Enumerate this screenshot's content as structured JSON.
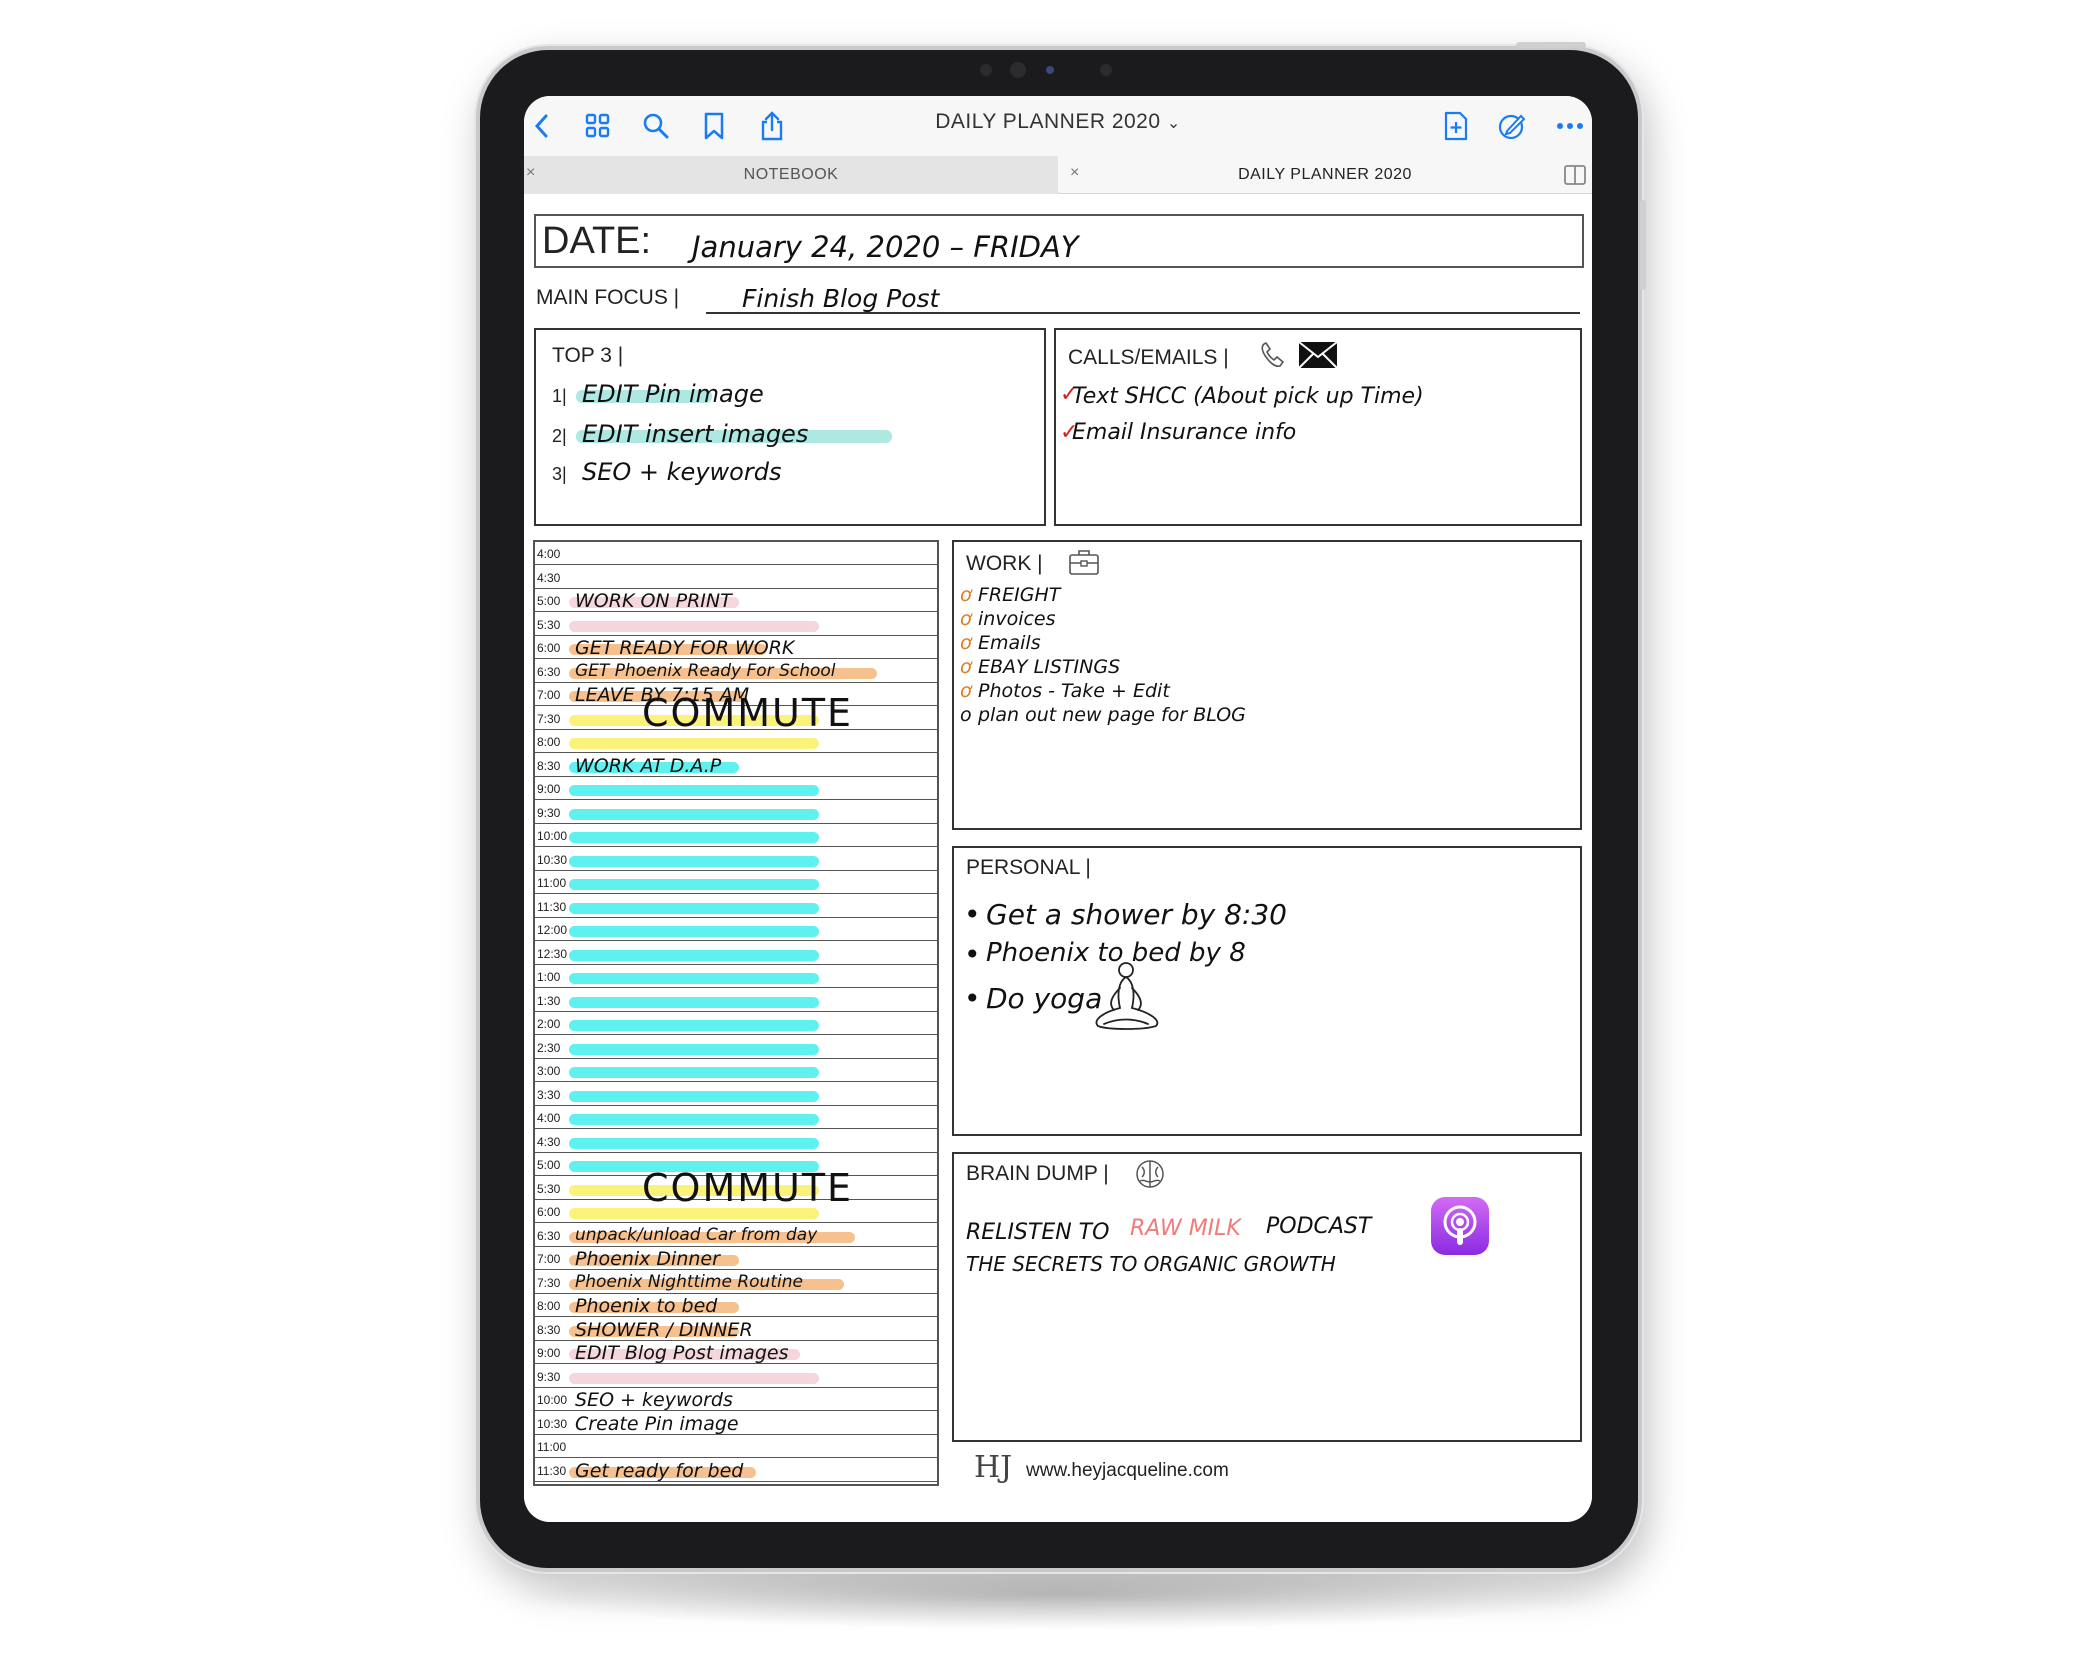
{
  "toolbar": {
    "back_icon": "chevron-left-icon",
    "grid_icon": "grid-icon",
    "search_icon": "search-icon",
    "bookmark_icon": "bookmark-icon",
    "share_icon": "share-icon",
    "title": "DAILY PLANNER 2020",
    "title_chevron": "⌄",
    "add_page_icon": "add-page-icon",
    "pen_icon": "pen-icon",
    "more_icon": "more-icon",
    "accent": "#1a7cf5"
  },
  "tabs": [
    {
      "label": "NOTEBOOK",
      "close": "×"
    },
    {
      "label": "DAILY PLANNER 2020",
      "close": "×"
    }
  ],
  "planner": {
    "date_label": "DATE:",
    "date_value": "January 24, 2020 – FRIDAY",
    "main_focus_label": "MAIN FOCUS  |",
    "main_focus_value": "Finish Blog Post",
    "top3": {
      "title": "TOP 3 |",
      "items": [
        {
          "num": "1|",
          "text": "EDIT Pin image"
        },
        {
          "num": "2|",
          "text": "EDIT insert images"
        },
        {
          "num": "3|",
          "text": "SEO + keywords"
        }
      ]
    },
    "calls": {
      "title": "CALLS/EMAILS |",
      "items": [
        {
          "check": "✓",
          "text": "Text SHCC (About pick up Time)"
        },
        {
          "check": "✓",
          "text": "Email Insurance info"
        }
      ]
    },
    "work": {
      "title": "WORK |",
      "items": [
        {
          "mark": "ơ",
          "text": "FREIGHT"
        },
        {
          "mark": "ơ",
          "text": "invoices"
        },
        {
          "mark": "ơ",
          "text": "Emails"
        },
        {
          "mark": "ơ",
          "text": "EBAY LISTINGS"
        },
        {
          "mark": "ơ",
          "text": "Photos - Take + Edit"
        },
        {
          "mark": "o",
          "text": "plan out new page for BLOG"
        }
      ]
    },
    "personal": {
      "title": "PERSONAL |",
      "items": [
        {
          "bullet": "•",
          "text": "Get a shower by 8:30"
        },
        {
          "bullet": "•",
          "text": "Phoenix to bed by 8"
        },
        {
          "bullet": "•",
          "text": "Do yoga"
        }
      ]
    },
    "brain_dump": {
      "title": "BRAIN DUMP |",
      "line1_prefix": "RELISTEN TO",
      "line1_highlight": "RAW MILK",
      "line1_suffix": "PODCAST",
      "line2": "THE SECRETS TO ORGANIC GROWTH",
      "podcast_icon": "podcast-icon"
    },
    "footer": {
      "logo": "HJ",
      "url": "www.heyjacqueline.com"
    },
    "schedule": [
      {
        "time": "4:00",
        "task": "",
        "color": ""
      },
      {
        "time": "4:30",
        "task": "",
        "color": ""
      },
      {
        "time": "5:00",
        "task": "WORK ON PRINT",
        "color": "#f4d6dc"
      },
      {
        "time": "5:30",
        "task": "",
        "color": "#f4d6dc"
      },
      {
        "time": "6:00",
        "task": "GET READY FOR WORK",
        "color": "#f6c18e"
      },
      {
        "time": "6:30",
        "task": "GET Phoenix Ready For School",
        "color": "#f6c18e"
      },
      {
        "time": "7:00",
        "task": "LEAVE BY 7:15 AM",
        "color": "#f6c18e"
      },
      {
        "time": "7:30",
        "task": "",
        "color": "#fbf27a"
      },
      {
        "time": "8:00",
        "task": "",
        "color": "#fbf27a"
      },
      {
        "time": "8:30",
        "task": "WORK AT D.A.P",
        "color": "#5ff0f0"
      },
      {
        "time": "9:00",
        "task": "",
        "color": "#5ff0f0"
      },
      {
        "time": "9:30",
        "task": "",
        "color": "#5ff0f0"
      },
      {
        "time": "10:00",
        "task": "",
        "color": "#5ff0f0"
      },
      {
        "time": "10:30",
        "task": "",
        "color": "#5ff0f0"
      },
      {
        "time": "11:00",
        "task": "",
        "color": "#5ff0f0"
      },
      {
        "time": "11:30",
        "task": "",
        "color": "#5ff0f0"
      },
      {
        "time": "12:00",
        "task": "",
        "color": "#5ff0f0"
      },
      {
        "time": "12:30",
        "task": "",
        "color": "#5ff0f0"
      },
      {
        "time": "1:00",
        "task": "",
        "color": "#5ff0f0"
      },
      {
        "time": "1:30",
        "task": "",
        "color": "#5ff0f0"
      },
      {
        "time": "2:00",
        "task": "",
        "color": "#5ff0f0"
      },
      {
        "time": "2:30",
        "task": "",
        "color": "#5ff0f0"
      },
      {
        "time": "3:00",
        "task": "",
        "color": "#5ff0f0"
      },
      {
        "time": "3:30",
        "task": "",
        "color": "#5ff0f0"
      },
      {
        "time": "4:00",
        "task": "",
        "color": "#5ff0f0"
      },
      {
        "time": "4:30",
        "task": "",
        "color": "#5ff0f0"
      },
      {
        "time": "5:00",
        "task": "",
        "color": "#5ff0f0"
      },
      {
        "time": "5:30",
        "task": "",
        "color": "#fbf27a"
      },
      {
        "time": "6:00",
        "task": "",
        "color": "#fbf27a"
      },
      {
        "time": "6:30",
        "task": "unpack/unload Car from day",
        "color": "#f6c18e"
      },
      {
        "time": "7:00",
        "task": "Phoenix Dinner",
        "color": "#f6c18e"
      },
      {
        "time": "7:30",
        "task": "Phoenix Nighttime Routine",
        "color": "#f6c18e"
      },
      {
        "time": "8:00",
        "task": "Phoenix to bed",
        "color": "#f6c18e"
      },
      {
        "time": "8:30",
        "task": "SHOWER / DINNER",
        "color": "#f6c18e"
      },
      {
        "time": "9:00",
        "task": "EDIT Blog Post images",
        "color": "#f4d6dc"
      },
      {
        "time": "9:30",
        "task": "",
        "color": "#f4d6dc"
      },
      {
        "time": "10:00",
        "task": "SEO + keywords",
        "color": ""
      },
      {
        "time": "10:30",
        "task": "Create Pin image",
        "color": ""
      },
      {
        "time": "11:00",
        "task": "",
        "color": ""
      },
      {
        "time": "11:30",
        "task": "Get ready for bed",
        "color": "#f6c18e"
      }
    ],
    "commute_label_1": "COMMUTE",
    "commute_label_2": "COMMUTE"
  }
}
